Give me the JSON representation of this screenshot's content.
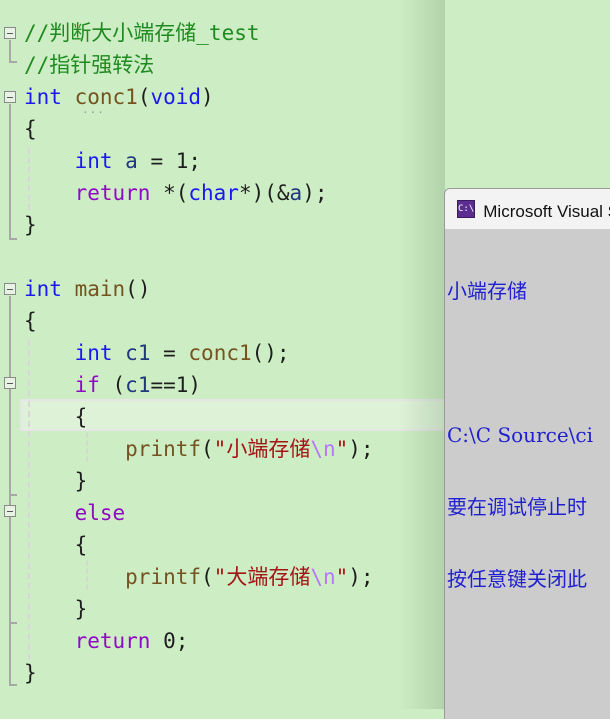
{
  "editor": {
    "lines": [
      {
        "parts": [
          {
            "c": "cmt",
            "t": "//判断大小端存储_test"
          }
        ]
      },
      {
        "parts": [
          {
            "c": "cmt",
            "t": "//指针强转法"
          }
        ]
      },
      {
        "parts": [
          {
            "c": "kw",
            "t": "int"
          },
          {
            "c": "pl",
            "t": " "
          },
          {
            "c": "fn",
            "t": "conc1"
          },
          {
            "c": "pl",
            "t": "("
          },
          {
            "c": "kw",
            "t": "void"
          },
          {
            "c": "pl",
            "t": ")"
          }
        ]
      },
      {
        "parts": [
          {
            "c": "pl",
            "t": "{"
          }
        ]
      },
      {
        "parts": [
          {
            "c": "pl",
            "t": "    "
          },
          {
            "c": "kw",
            "t": "int"
          },
          {
            "c": "pl",
            "t": " "
          },
          {
            "c": "var",
            "t": "a"
          },
          {
            "c": "pl",
            "t": " = 1;"
          }
        ]
      },
      {
        "parts": [
          {
            "c": "pl",
            "t": "    "
          },
          {
            "c": "ctl",
            "t": "return"
          },
          {
            "c": "pl",
            "t": " *("
          },
          {
            "c": "kw",
            "t": "char"
          },
          {
            "c": "pl",
            "t": "*)(&"
          },
          {
            "c": "var",
            "t": "a"
          },
          {
            "c": "pl",
            "t": ");"
          }
        ]
      },
      {
        "parts": [
          {
            "c": "pl",
            "t": "}"
          }
        ]
      },
      {
        "parts": []
      },
      {
        "parts": [
          {
            "c": "kw",
            "t": "int"
          },
          {
            "c": "pl",
            "t": " "
          },
          {
            "c": "fn",
            "t": "main"
          },
          {
            "c": "pl",
            "t": "()"
          }
        ]
      },
      {
        "parts": [
          {
            "c": "pl",
            "t": "{"
          }
        ]
      },
      {
        "parts": [
          {
            "c": "pl",
            "t": "    "
          },
          {
            "c": "kw",
            "t": "int"
          },
          {
            "c": "pl",
            "t": " "
          },
          {
            "c": "var",
            "t": "c1"
          },
          {
            "c": "pl",
            "t": " = "
          },
          {
            "c": "fn",
            "t": "conc1"
          },
          {
            "c": "pl",
            "t": "();"
          }
        ]
      },
      {
        "parts": [
          {
            "c": "pl",
            "t": "    "
          },
          {
            "c": "ctl",
            "t": "if"
          },
          {
            "c": "pl",
            "t": " ("
          },
          {
            "c": "var",
            "t": "c1"
          },
          {
            "c": "pl",
            "t": "==1)"
          }
        ]
      },
      {
        "parts": [
          {
            "c": "pl",
            "t": "    {"
          }
        ]
      },
      {
        "parts": [
          {
            "c": "pl",
            "t": "        "
          },
          {
            "c": "fn",
            "t": "printf"
          },
          {
            "c": "pl",
            "t": "("
          },
          {
            "c": "str",
            "t": "\"小端存储"
          },
          {
            "c": "esc",
            "t": "\\n"
          },
          {
            "c": "str",
            "t": "\""
          },
          {
            "c": "pl",
            "t": ");"
          }
        ]
      },
      {
        "parts": [
          {
            "c": "pl",
            "t": "    }"
          }
        ]
      },
      {
        "parts": [
          {
            "c": "pl",
            "t": "    "
          },
          {
            "c": "ctl",
            "t": "else"
          }
        ]
      },
      {
        "parts": [
          {
            "c": "pl",
            "t": "    {"
          }
        ]
      },
      {
        "parts": [
          {
            "c": "pl",
            "t": "        "
          },
          {
            "c": "fn",
            "t": "printf"
          },
          {
            "c": "pl",
            "t": "("
          },
          {
            "c": "str",
            "t": "\"大端存储"
          },
          {
            "c": "esc",
            "t": "\\n"
          },
          {
            "c": "str",
            "t": "\""
          },
          {
            "c": "pl",
            "t": ");"
          }
        ]
      },
      {
        "parts": [
          {
            "c": "pl",
            "t": "    }"
          }
        ]
      },
      {
        "parts": [
          {
            "c": "pl",
            "t": "    "
          },
          {
            "c": "ctl",
            "t": "return"
          },
          {
            "c": "pl",
            "t": " 0;"
          }
        ]
      },
      {
        "parts": [
          {
            "c": "pl",
            "t": "}"
          }
        ]
      }
    ],
    "collapse_hint": "..."
  },
  "console": {
    "icon_label": "C:\\",
    "title": "Microsoft Visual Studio 调试控制台",
    "output_lines": [
      "小端存储",
      "",
      "C:\\C Source\\ci",
      "要在调试停止时",
      "按任意键关闭此"
    ]
  }
}
